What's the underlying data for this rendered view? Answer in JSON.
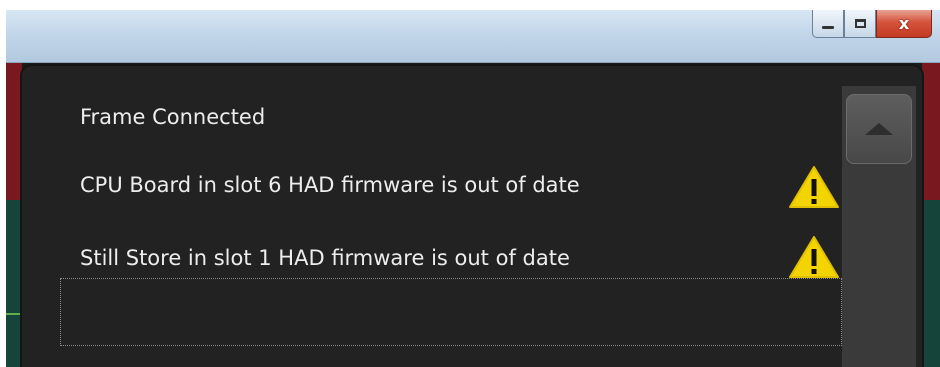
{
  "window": {
    "caption_buttons": {
      "minimize_icon": "minimize-icon",
      "maximize_icon": "maximize-icon",
      "close_glyph": "x"
    }
  },
  "messages": [
    {
      "text": "Frame Connected",
      "warning": false
    },
    {
      "text": "CPU Board in slot 6 HAD firmware is out of date",
      "warning": true
    },
    {
      "text": "Still Store in slot 1 HAD firmware is out of date",
      "warning": true,
      "selected": true
    }
  ],
  "colors": {
    "panel_bg": "#222222",
    "text": "#ededed",
    "warning_yellow": "#f4d400",
    "close_red": "#c43a22"
  },
  "icons": {
    "warning": "warning-icon",
    "scroll_up": "scroll-up-icon"
  }
}
